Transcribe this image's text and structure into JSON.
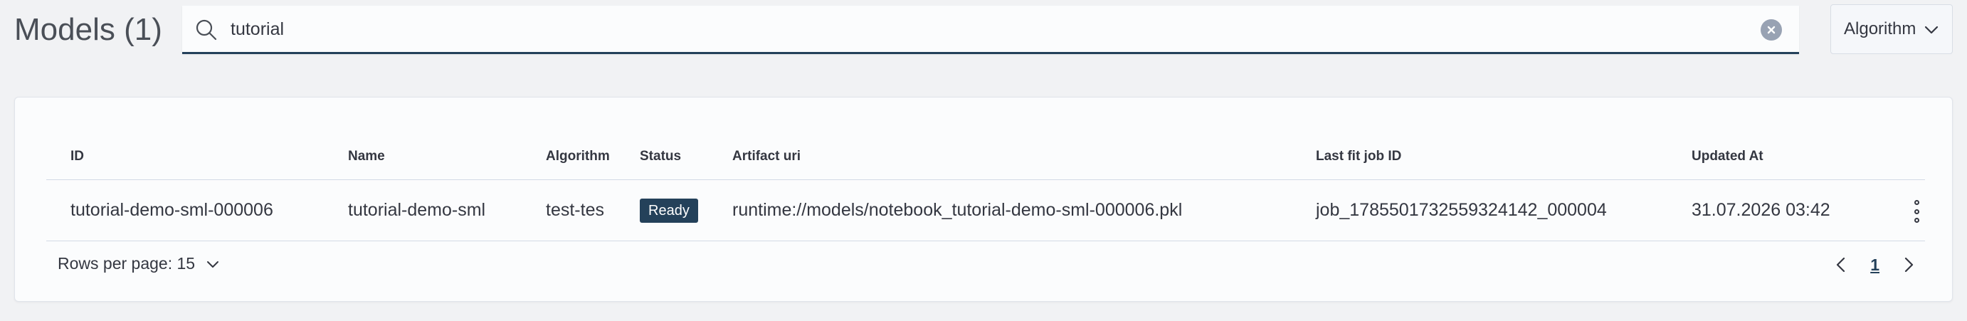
{
  "header": {
    "title": "Models (1)",
    "search": {
      "value": "tutorial",
      "placeholder": ""
    },
    "algorithm_filter_label": "Algorithm"
  },
  "table": {
    "columns": [
      "ID",
      "Name",
      "Algorithm",
      "Status",
      "Artifact uri",
      "Last fit job ID",
      "Updated At"
    ],
    "rows": [
      {
        "id": "tutorial-demo-sml-000006",
        "name": "tutorial-demo-sml",
        "algorithm": "test-tes",
        "status": "Ready",
        "artifact_uri": "runtime://models/notebook_tutorial-demo-sml-000006.pkl",
        "last_fit_job_id": "job_1785501732559324142_000004",
        "updated_at": "31.07.2026 03:42"
      }
    ]
  },
  "pagination": {
    "rows_per_page_label": "Rows per page: 15",
    "current_page": "1"
  },
  "colors": {
    "accent": "#24415a",
    "background": "#f1f2f4",
    "panel": "#fbfcfd",
    "text": "#343741"
  },
  "icons": [
    "search-icon",
    "clear-icon",
    "chevron-down-icon",
    "more-vertical-icon",
    "chevron-left-icon",
    "chevron-right-icon"
  ]
}
